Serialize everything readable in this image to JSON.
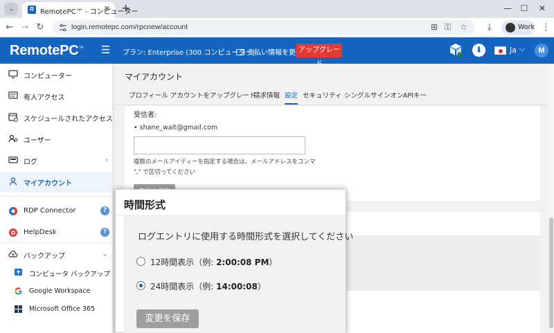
{
  "browser": {
    "tab_title": "RemotePC™ - コンピューター",
    "url": "login.remotepc.com/rpcnew/account",
    "profile_label": "Work"
  },
  "header": {
    "logo": "RemotePC",
    "logo_tm": "™",
    "plan": "プラン: Enterprise (300 コンピューター)",
    "payment": "支払い情報を更新",
    "upgrade": "アップグレード",
    "lang": "Ja",
    "user_initial": "M",
    "brand_color": "#1565c0",
    "upgrade_color": "#e53935"
  },
  "sidebar": {
    "items": [
      {
        "label": "コンピューター",
        "icon": "monitor-icon"
      },
      {
        "label": "有人アクセス",
        "icon": "screen-share-icon"
      },
      {
        "label": "スケジュールされたアクセス",
        "icon": "calendar-icon"
      },
      {
        "label": "ユーザー",
        "icon": "users-icon"
      },
      {
        "label": "ログ",
        "icon": "log-icon"
      },
      {
        "label": "マイアカウント",
        "icon": "user-icon"
      },
      {
        "label": "RDP Connector",
        "icon": "rdp-icon"
      },
      {
        "label": "HelpDesk",
        "icon": "helpdesk-icon"
      },
      {
        "label": "バックアップ",
        "icon": "cloud-upload-icon"
      }
    ],
    "sub_items": [
      {
        "label": "コンピュータ バックアップ",
        "icon": "computer-backup-icon"
      },
      {
        "label": "Google Workspace",
        "icon": "google-icon"
      },
      {
        "label": "Microsoft Office 365",
        "icon": "windows-icon"
      }
    ]
  },
  "main": {
    "title": "マイアカウント",
    "tabs": [
      "プロフィール",
      "アカウントをアップグレード",
      "請求情報",
      "設定",
      "セキュリティ",
      "シングルサインオン",
      "APIキー"
    ],
    "active_tab": "設定",
    "recipients_label": "受信者:",
    "recipient_email": "shane_walt@gmail.com",
    "email_input_value": "",
    "hint_line1": "複数のメールアイディーを指定する場合は、メールアドレスをコンマ",
    "hint_line2": "\",\" で区切ってください",
    "save_label": "変更を保存"
  },
  "zoom": {
    "title": "時間形式",
    "question": "ログエントリに使用する時間形式を選択してください",
    "option1_prefix": "12時間表示（例: ",
    "option1_example": "2:00:08 PM",
    "option1_suffix": "）",
    "option2_prefix": "24時間表示（例: ",
    "option2_example": "14:00:08",
    "option2_suffix": "）",
    "selected_option": "24時間表示",
    "save_label": "変更を保存"
  }
}
